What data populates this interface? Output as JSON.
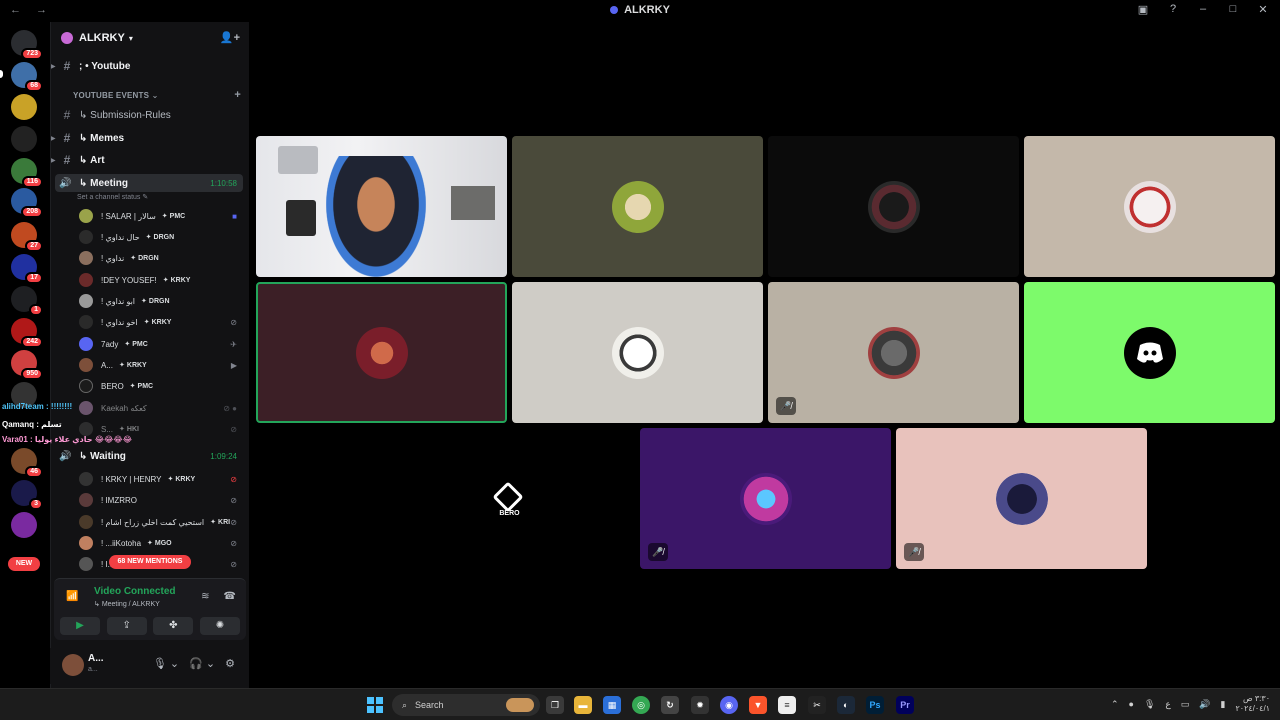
{
  "window": {
    "title": "ALKRKY"
  },
  "rail": {
    "badges": [
      "723",
      "68",
      "116",
      "208",
      "27",
      "17",
      "1",
      "242",
      "950",
      "46",
      "3"
    ],
    "new_label": "NEW"
  },
  "server": {
    "name": "ALKRKY"
  },
  "channels": {
    "youtube": "; • Youtube",
    "category_events": "YOUTUBE EVENTS",
    "submission": "Submission-Rules",
    "memes": "Memes",
    "art": "Art"
  },
  "meeting": {
    "name": "Meeting",
    "timer": "1:10:58",
    "status_placeholder": "Set a channel status",
    "members": [
      {
        "name": "! SALAR | سالار",
        "tag": "PMC",
        "color": "#9aa34a"
      },
      {
        "name": "! حال نداوي",
        "tag": "DRGN",
        "color": "#2b2b2b"
      },
      {
        "name": "! نداوي",
        "tag": "DRGN",
        "color": "#8b6f5e"
      },
      {
        "name": "!DEY YOUSEF!",
        "tag": "KRKY",
        "color": "#6b2a2a"
      },
      {
        "name": "! ابو نداوي",
        "tag": "DRGN",
        "color": "#9a9a9a"
      },
      {
        "name": "! اخو نداوي",
        "tag": "KRKY",
        "color": "#2a2a2a"
      },
      {
        "name": "7ady",
        "tag": "PMC",
        "color": "#5865f2"
      },
      {
        "name": "A...",
        "tag": "KRKY",
        "color": "#7d4f3a"
      },
      {
        "name": "BERO",
        "tag": "PMC",
        "color": "#1b1b1b"
      },
      {
        "name": "Kaekah كعكه",
        "tag": "",
        "color": "#b38bb5"
      },
      {
        "name": "S...",
        "tag": "HKI",
        "color": "#444"
      }
    ]
  },
  "waiting": {
    "name": "Waiting",
    "timer": "1:09:24",
    "members": [
      {
        "name": "! KRKY | HENRY",
        "tag": "KRKY",
        "color": "#333"
      },
      {
        "name": "! IMZRRO",
        "tag": "",
        "color": "#5a3a3a"
      },
      {
        "name": "! استحيي كمت اخلي زراح اشام",
        "tag": "KRI",
        "color": "#4a3a2a"
      },
      {
        "name": "! ...iiKotoha",
        "tag": "MGO",
        "color": "#c08060"
      },
      {
        "name": "! I...",
        "tag": "",
        "color": "#555"
      }
    ],
    "mentions": "68 NEW MENTIONS"
  },
  "overlay": {
    "line1": "alihd7team : !!!!!!!!",
    "line2": "Qamanq : تسلم",
    "line3": "Vara01 : حادي علاء يوليا 😂😂😂😂"
  },
  "voice_panel": {
    "status": "Video Connected",
    "location": "Meeting / ALKRKY"
  },
  "user": {
    "name": "A...",
    "sub": "a..."
  },
  "tiles": [
    {
      "kind": "camera",
      "bg": "#e8e8ea",
      "muted": false
    },
    {
      "kind": "avatar",
      "bg": "#4a4a3a",
      "avatar": "#8fa63a",
      "muted": false
    },
    {
      "kind": "avatar",
      "bg": "#0b0b0b",
      "avatar": "#5a2a30",
      "muted": false
    },
    {
      "kind": "avatar",
      "bg": "#c4b8aa",
      "avatar": "#e8e0e0",
      "muted": false
    },
    {
      "kind": "avatar",
      "bg": "#3c1f26",
      "avatar": "#7a1e2a",
      "muted": false,
      "speaking": true
    },
    {
      "kind": "avatar",
      "bg": "#cfccc6",
      "avatar": "#f0efea",
      "muted": false
    },
    {
      "kind": "avatar",
      "bg": "#b9b1a4",
      "avatar": "#3a3a3a",
      "muted": true
    },
    {
      "kind": "discord",
      "bg": "#7dfa6b",
      "muted": false
    },
    {
      "kind": "bero",
      "bg": "#000000",
      "label": "BERO",
      "muted": false
    },
    {
      "kind": "avatar",
      "bg": "#3b1668",
      "avatar": "#c03aa0",
      "muted": true
    },
    {
      "kind": "avatar",
      "bg": "#e8c2bc",
      "avatar": "#4a4a8a",
      "muted": true
    }
  ],
  "taskbar": {
    "search_label": "Search",
    "clock_time": "٣:٣٠ ص",
    "clock_date": "٢٠٢٤/٠٤/١",
    "lang": "ع"
  }
}
